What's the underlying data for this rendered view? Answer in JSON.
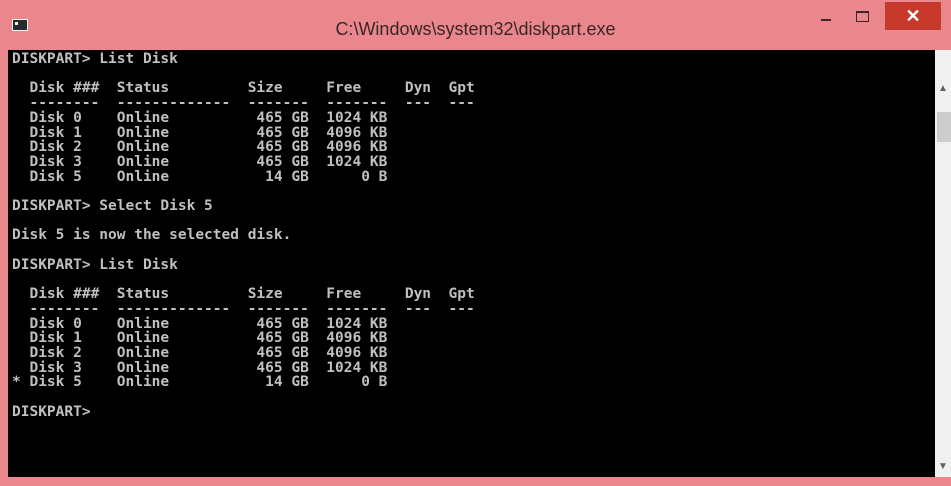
{
  "window": {
    "title": "C:\\Windows\\system32\\diskpart.exe",
    "minimize_glyph": "",
    "maximize_glyph": "",
    "close_glyph": "✕"
  },
  "scrollbar": {
    "up_glyph": "▲",
    "down_glyph": "▼"
  },
  "console": {
    "lines": [
      "DISKPART> List Disk",
      "",
      "  Disk ###  Status         Size     Free     Dyn  Gpt",
      "  --------  -------------  -------  -------  ---  ---",
      "  Disk 0    Online          465 GB  1024 KB",
      "  Disk 1    Online          465 GB  4096 KB",
      "  Disk 2    Online          465 GB  4096 KB",
      "  Disk 3    Online          465 GB  1024 KB",
      "  Disk 5    Online           14 GB      0 B",
      "",
      "DISKPART> Select Disk 5",
      "",
      "Disk 5 is now the selected disk.",
      "",
      "DISKPART> List Disk",
      "",
      "  Disk ###  Status         Size     Free     Dyn  Gpt",
      "  --------  -------------  -------  -------  ---  ---",
      "  Disk 0    Online          465 GB  1024 KB",
      "  Disk 1    Online          465 GB  4096 KB",
      "  Disk 2    Online          465 GB  4096 KB",
      "  Disk 3    Online          465 GB  1024 KB",
      "* Disk 5    Online           14 GB      0 B",
      "",
      "DISKPART> "
    ]
  },
  "colors": {
    "titlebar": "#e9878c",
    "close_button": "#c7392b",
    "console_bg": "#000000",
    "console_text": "#c0c0c0"
  }
}
